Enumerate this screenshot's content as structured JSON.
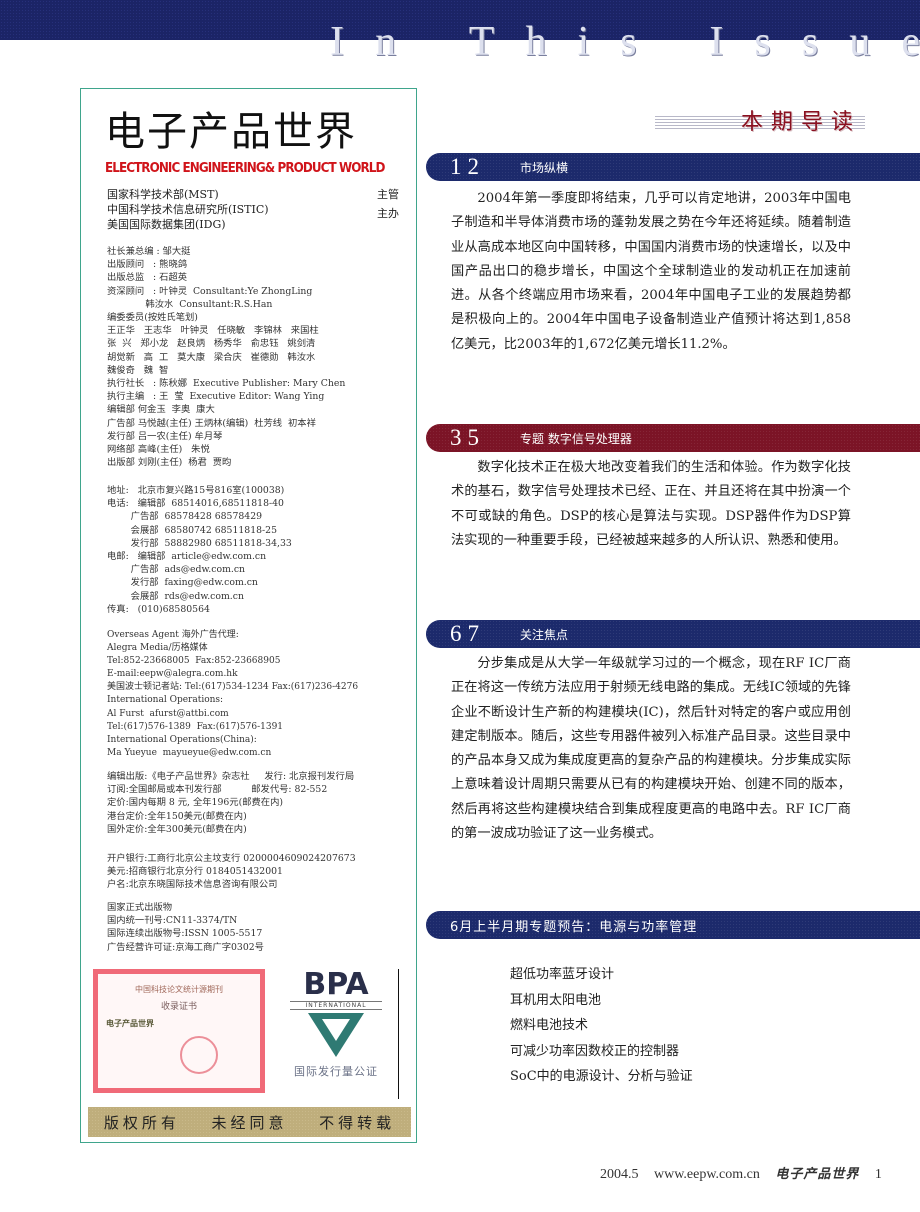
{
  "banner": {
    "title_letters": [
      "I",
      "n",
      " ",
      " ",
      "T",
      "h",
      "i",
      "s",
      " ",
      " ",
      "I",
      "s",
      "s",
      "u",
      "e"
    ]
  },
  "masthead": {
    "title": "电子产品世界",
    "subtitle": "ELECTRONIC ENGINEERING& PRODUCT WORLD",
    "sponsors": [
      {
        "name": "国家科学技术部(MST)",
        "role": "主管"
      },
      {
        "name": "中国科学技术信息研究所(ISTIC)",
        "role": "主办"
      },
      {
        "name": "美国国际数据集团(IDG)",
        "role": ""
      }
    ],
    "staff_block": "社长兼总编 : 邹大挺\n出版顾问   : 熊晓鸽\n出版总监   : 石超英\n资深顾问   : 叶钟灵  Consultant:Ye ZhongLing\n             韩汝水  Consultant:R.S.Han\n编委委员(按姓氏笔划)\n王正华   王志华   叶钟灵   任晓敏   李锦林   来国柱\n张  兴   郑小龙   赵良炳   杨秀华   俞忠钰   姚剑清\n胡觉新   高  工   莫大康   梁合庆   崔德勋   韩汝水\n魏俊奇   魏  智\n执行社长   : 陈秋娜  Executive Publisher: Mary Chen\n执行主编   : 王  莹  Executive Editor: Wang Ying\n编辑部 何金玉  李奥  康大\n广告部 马悦越(主任) 王炳林(编辑)  杜芳线  初本祥\n发行部 吕一农(主任) 牟月琴\n网络部 高峰(主任)   朱悦\n出版部 刘刚(主任)  杨君  贾昀",
    "contact_block": "地址:   北京市复兴路15号816室(100038)\n电话:   编辑部  68514016,68511818-40\n        广告部  68578428 68578429\n        会展部  68580742 68511818-25\n        发行部  58882980 68511818-34,33\n电邮:   编辑部  article@edw.com.cn\n        广告部  ads@edw.com.cn\n        发行部  faxing@edw.com.cn\n        会展部  rds@edw.com.cn\n传真:   (010)68580564",
    "overseas_block": "Overseas Agent 海外广告代理:\nAlegra Media/历格媒体\nTel:852-23668005  Fax:852-23668905\nE-mail:eepw@alegra.com.hk\n美国波士顿记者站: Tel:(617)534-1234 Fax:(617)236-4276\nInternational Operations:\nAl Furst  afurst@attbi.com\nTel:(617)576-1389  Fax:(617)576-1391\nInternational Operations(China):\nMa Yueyue  mayueyue@edw.com.cn",
    "publish_block": "编辑出版:《电子产品世界》杂志社     发行: 北京报刊发行局\n订阅:全国邮局或本刊发行部          邮发代号: 82-552\n定价:国内每期 8 元, 全年196元(邮费在内)\n港台定价:全年150美元(邮费在内)\n国外定价:全年300美元(邮费在内)",
    "bank_block": "开户银行:工商行北京公主坟支行 0200004609024207673\n美元:招商银行北京分行 0184051432001\n户名:北京东晓国际技术信息咨询有限公司",
    "license_block": "国家正式出版物\n国内统一刊号:CN11-3374/TN\n国际连续出版物号:ISSN 1005-5517\n广告经营许可证:京海工商广字0302号",
    "certificate": {
      "heading": "中国科技论文统计源期刊",
      "subheading": "收录证书",
      "recipient": "电子产品世界"
    },
    "bpa": {
      "logo_text": "BPA",
      "international": "INTERNATIONAL",
      "label": "国际发行量公证"
    },
    "rights": [
      "版权所有",
      "未经同意",
      "不得转载"
    ]
  },
  "contents": {
    "section_title": "本期导读",
    "articles": [
      {
        "page": "12",
        "category": "市场纵横",
        "summary": "2004年第一季度即将结束，几乎可以肯定地讲，2003年中国电子制造和半导体消费市场的蓬勃发展之势在今年还将延续。随着制造业从高成本地区向中国转移，中国国内消费市场的快速增长，以及中国产品出口的稳步增长，中国这个全球制造业的发动机正在加速前进。从各个终端应用市场来看，2004年中国电子工业的发展趋势都是积极向上的。2004年中国电子设备制造业产值预计将达到1,858亿美元，比2003年的1,672亿美元增长11.2%。"
      },
      {
        "page": "35",
        "category": "专题  数字信号处理器",
        "summary": "数字化技术正在极大地改变着我们的生活和体验。作为数字化技术的基石，数字信号处理技术已经、正在、并且还将在其中扮演一个不可或缺的角色。DSP的核心是算法与实现。DSP器件作为DSP算法实现的一种重要手段，已经被越来越多的人所认识、熟悉和使用。"
      },
      {
        "page": "67",
        "category": "关注焦点",
        "summary": "分步集成是从大学一年级就学习过的一个概念，现在RF IC厂商正在将这一传统方法应用于射频无线电路的集成。无线IC领域的先锋企业不断设计生产新的构建模块(IC)，然后针对特定的客户或应用创建定制版本。随后，这些专用器件被列入标准产品目录。这些目录中的产品本身又成为集成度更高的复杂产品的构建模块。分步集成实际上意味着设计周期只需要从已有的构建模块开始、创建不同的版本，然后再将这些构建模块结合到集成程度更高的电路中去。RF IC厂商的第一波成功验证了这一业务模式。"
      }
    ],
    "preview": {
      "title": "6月上半月期专题预告：电源与功率管理",
      "items": [
        "超低功率蓝牙设计",
        "耳机用太阳电池",
        "燃料电池技术",
        "可减少功率因数校正的控制器",
        "SoC中的电源设计、分析与验证"
      ]
    }
  },
  "footer": {
    "issue": "2004.5",
    "url": "www.eepw.com.cn",
    "magazine": "电子产品世界",
    "page_number": "1"
  },
  "colors": {
    "banner_navy": "#1b2466",
    "section_red": "#7b1426",
    "masthead_border": "#3fa58c",
    "subtitle_red": "#d0141a",
    "rights_tan": "#bfae7c"
  }
}
